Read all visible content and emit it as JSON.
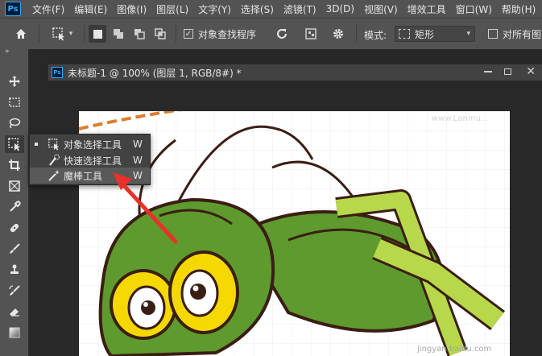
{
  "app": {
    "logo_text": "Ps"
  },
  "menu": {
    "items": [
      "文件(F)",
      "编辑(E)",
      "图像(I)",
      "图层(L)",
      "文字(Y)",
      "选择(S)",
      "滤镜(T)",
      "3D(D)",
      "视图(V)",
      "增效工具",
      "窗口(W)",
      "帮助(H)"
    ]
  },
  "options": {
    "object_finder_label": "对象查找程序",
    "object_finder_checked": true,
    "mode_label": "模式:",
    "mode_value": "矩形",
    "sample_all_label": "对所有图",
    "sample_all_checked": false
  },
  "document": {
    "icon_text": "Ps",
    "tab_title": "未标题-1 @ 100% (图层 1, RGB/8#) *",
    "watermark_top": "www.Lanmu...",
    "watermark_bottom": "jingyan.baidu.com"
  },
  "flyout": {
    "items": [
      {
        "label": "对象选择工具",
        "shortcut": "W",
        "icon": "object-selection-icon",
        "active": true
      },
      {
        "label": "快速选择工具",
        "shortcut": "W",
        "icon": "quick-selection-icon",
        "active": false
      },
      {
        "label": "魔棒工具",
        "shortcut": "W",
        "icon": "magic-wand-icon",
        "active": false
      }
    ]
  },
  "colors": {
    "panel": "#535353",
    "background": "#282828",
    "arrow": "#e8312a",
    "grasshopper_green": "#5e9a2e",
    "grasshopper_light": "#b7d84a",
    "eye_yellow": "#f5d800",
    "outline": "#3a1e14",
    "dash_orange": "#e07b2d"
  }
}
